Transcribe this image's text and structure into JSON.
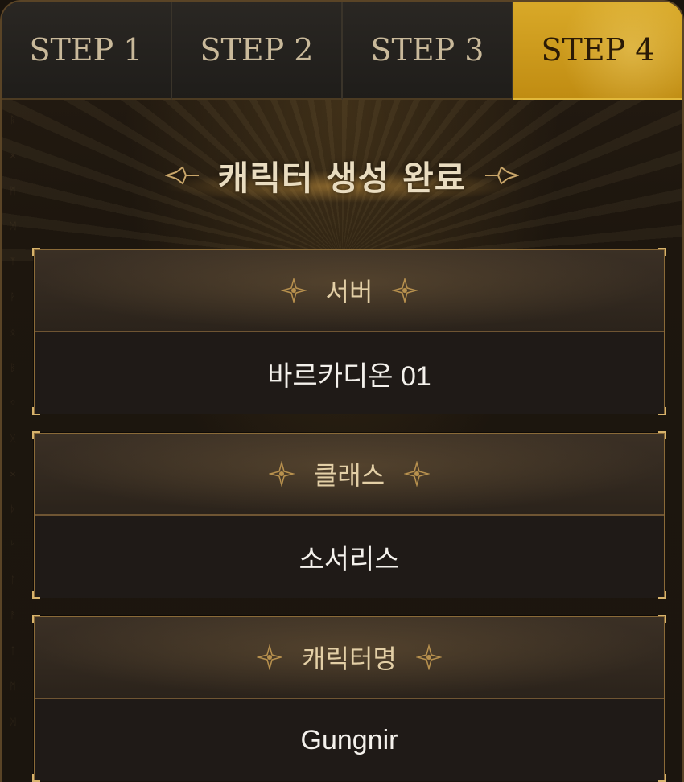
{
  "tabs": [
    {
      "label": "STEP 1",
      "active": false
    },
    {
      "label": "STEP 2",
      "active": false
    },
    {
      "label": "STEP 3",
      "active": false
    },
    {
      "label": "STEP 4",
      "active": true
    }
  ],
  "heading": {
    "title": "캐릭터 생성 완료"
  },
  "summary": {
    "server": {
      "label": "서버",
      "value": "바르카디온 01"
    },
    "class": {
      "label": "클래스",
      "value": "소서리스"
    },
    "character_name": {
      "label": "캐릭터명",
      "value": "Gungnir"
    }
  },
  "colors": {
    "active_tab": "#c8950f",
    "accent_gold": "#d7b36c",
    "background": "#1b150e"
  }
}
